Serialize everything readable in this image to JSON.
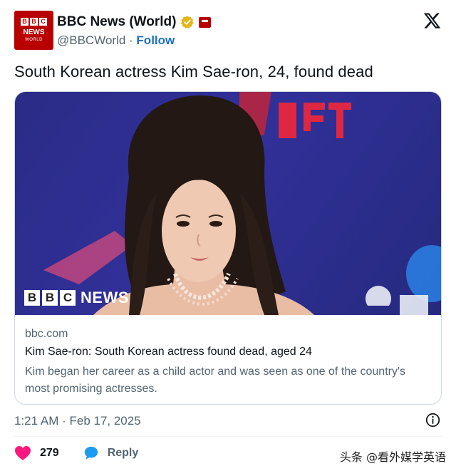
{
  "account": {
    "avatar_blocks": [
      "B",
      "B",
      "C"
    ],
    "avatar_news": "NEWS",
    "avatar_world": "WORLD",
    "name": "BBC News (World)",
    "handle": "@BBCWorld",
    "separator": " · ",
    "follow_label": "Follow"
  },
  "tweet": {
    "text": "South Korean actress Kim Sae-ron, 24, found dead"
  },
  "card": {
    "image_logo_blocks": [
      "B",
      "B",
      "C"
    ],
    "image_logo_text": "NEWS",
    "domain": "bbc.com",
    "title": "Kim Sae-ron: South Korean actress found dead, aged 24",
    "description": "Kim began her career as a child actor and was seen as one of the country's most promising actresses."
  },
  "meta": {
    "timestamp": "1:21 AM · Feb 17, 2025"
  },
  "actions": {
    "likes": "279",
    "reply_label": "Reply"
  },
  "watermark": "头条 @看外媒学英语",
  "icons": {
    "verified": "verified-badge-icon",
    "affiliation": "affiliation-badge-icon",
    "logo": "x-logo-icon",
    "info": "info-icon",
    "like": "heart-icon",
    "reply": "reply-bubble-icon"
  },
  "colors": {
    "brand_red": "#b80000",
    "link_blue": "#1d6fc9",
    "like_pink": "#f91880",
    "reply_blue": "#1d9bf0",
    "verified_gold": "#e2b719",
    "text_primary": "#0f1419",
    "text_secondary": "#536471"
  }
}
